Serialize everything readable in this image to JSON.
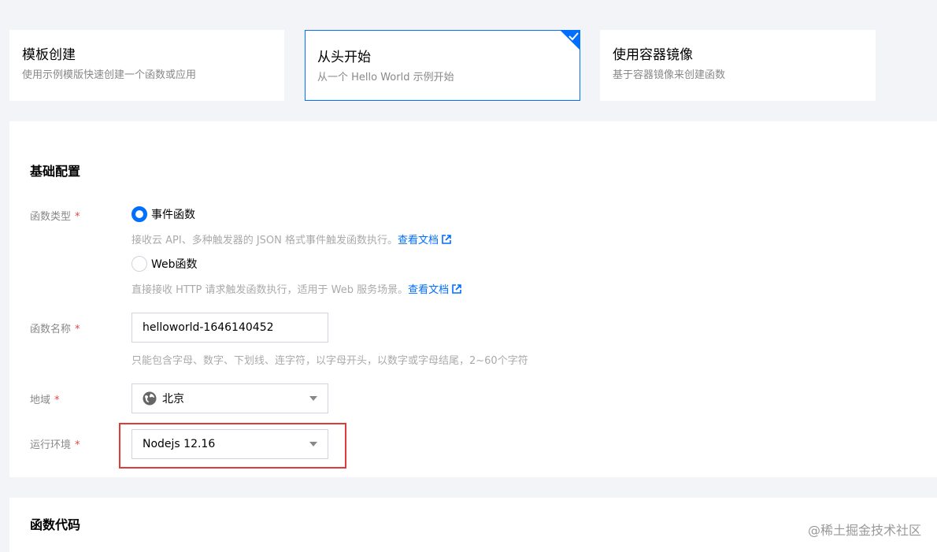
{
  "creation_methods": [
    {
      "title": "模板创建",
      "desc": "使用示例模版快速创建一个函数或应用",
      "selected": false
    },
    {
      "title": "从头开始",
      "desc": "从一个 Hello World 示例开始",
      "selected": true
    },
    {
      "title": "使用容器镜像",
      "desc": "基于容器镜像来创建函数",
      "selected": false
    }
  ],
  "basic_config": {
    "title": "基础配置",
    "function_type": {
      "label": "函数类型",
      "required_mark": "*",
      "options": [
        {
          "label": "事件函数",
          "hint": "接收云 API、多种触发器的 JSON 格式事件触发函数执行。",
          "link": "查看文档",
          "checked": true
        },
        {
          "label": "Web函数",
          "hint": "直接接收 HTTP 请求触发函数执行，适用于 Web 服务场景。",
          "link": "查看文档",
          "checked": false
        }
      ]
    },
    "function_name": {
      "label": "函数名称",
      "required_mark": "*",
      "value": "helloworld-1646140452",
      "hint": "只能包含字母、数字、下划线、连字符，以字母开头，以数字或字母结尾，2~60个字符"
    },
    "region": {
      "label": "地域",
      "required_mark": "*",
      "value": "北京",
      "icon": "globe-icon"
    },
    "runtime": {
      "label": "运行环境",
      "required_mark": "*",
      "value": "Nodejs 12.16"
    }
  },
  "function_code": {
    "title": "函数代码"
  },
  "watermark": "@稀土掘金技术社区",
  "colors": {
    "accent": "#006eff",
    "required": "#e54545",
    "highlight": "#e03b3b"
  }
}
